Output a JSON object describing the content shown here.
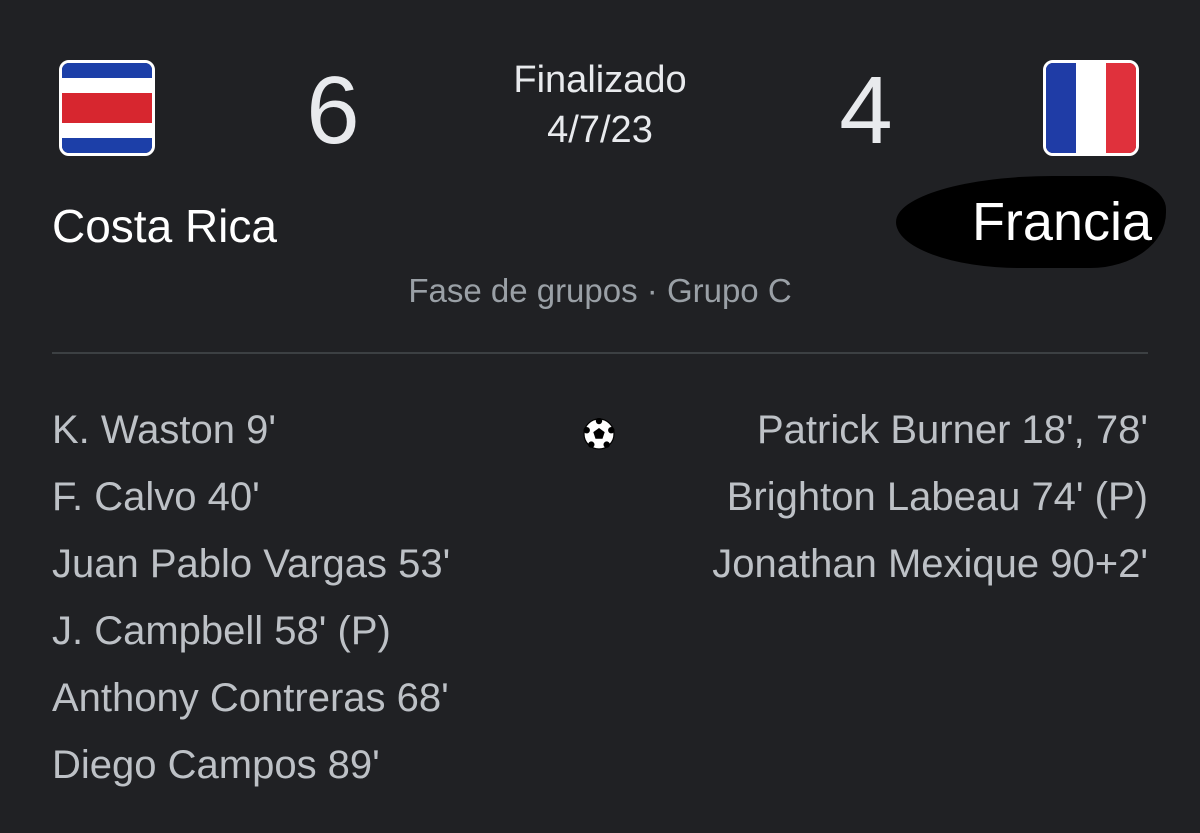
{
  "match": {
    "status": "Finalizado",
    "date": "4/7/23",
    "stage": "Fase de grupos · Grupo C"
  },
  "home": {
    "name": "Costa Rica",
    "score": "6",
    "flag_icon": "costa-rica-flag-icon",
    "flag_colors": [
      "#1c3fa8",
      "#ffffff",
      "#d7262f",
      "#ffffff",
      "#1c3fa8"
    ],
    "scorers": [
      "K. Waston 9'",
      "F. Calvo 40'",
      "Juan Pablo Vargas 53'",
      "J. Campbell 58' (P)",
      "Anthony Contreras 68'",
      "Diego Campos 89'"
    ]
  },
  "away": {
    "name": "Francia",
    "score": "4",
    "flag_icon": "france-flag-icon",
    "flag_colors": [
      "#1f3ca6",
      "#ffffff",
      "#e0313c"
    ],
    "scorers": [
      "Patrick Burner 18', 78'",
      "Brighton Labeau 74' (P)",
      "Jonathan Mexique 90+2'"
    ]
  },
  "goals_icon": "soccer-ball-icon",
  "colors": {
    "background": "#202124",
    "primary_text": "#e8eaed",
    "secondary_text": "#9aa0a6",
    "divider": "#3c4043"
  }
}
